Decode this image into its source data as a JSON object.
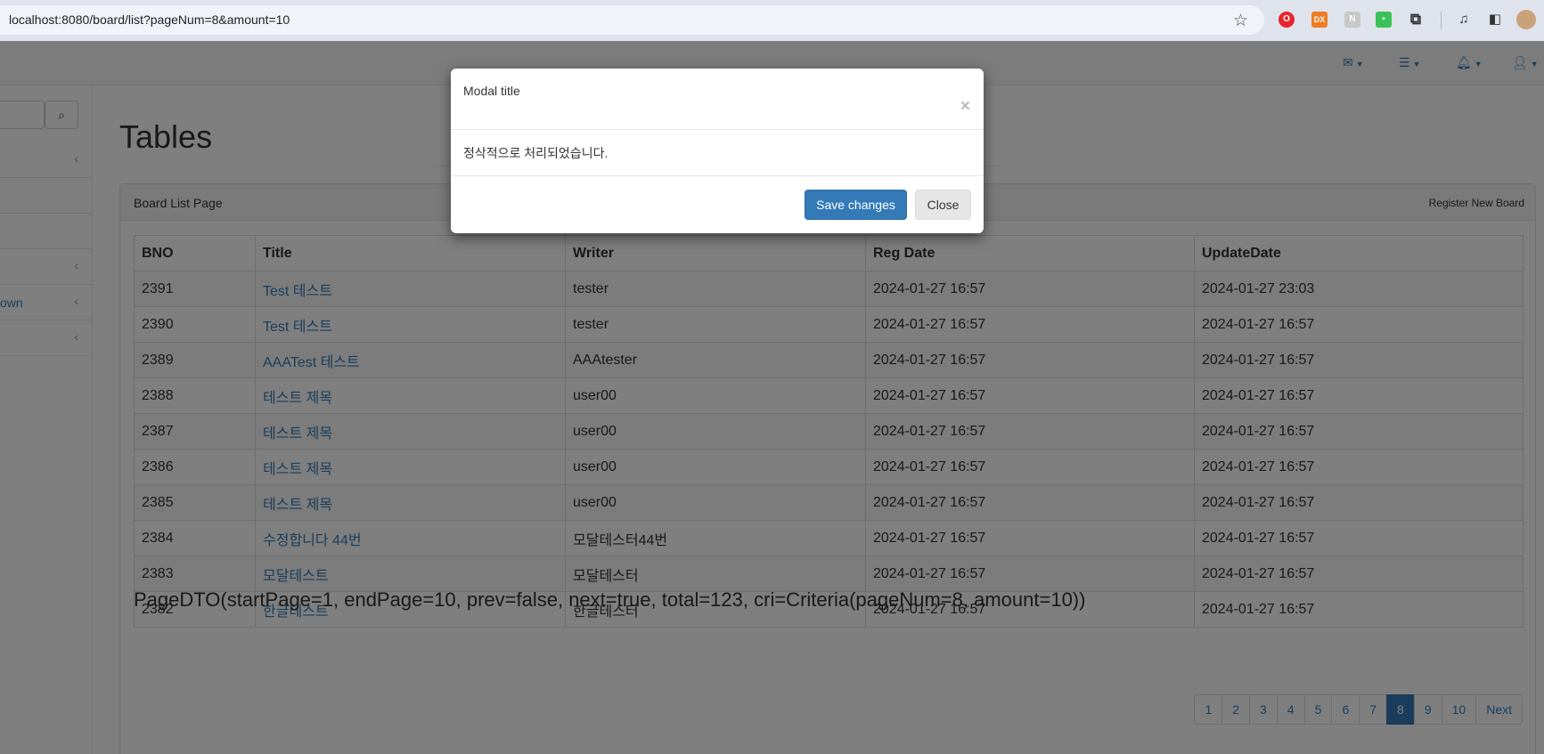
{
  "browser": {
    "url": "localhost:8080/board/list?pageNum=8&amount=10",
    "star_icon": "bookmark-star-icon",
    "extensions": [
      "opera-icon",
      "dx-icon",
      "n-icon",
      "green-ext-icon",
      "puzzle-icon",
      "media-icon",
      "sidepanel-icon",
      "profile-avatar-icon"
    ]
  },
  "header": {
    "icons": [
      "envelope-icon",
      "tasks-icon",
      "bell-icon",
      "user-icon"
    ]
  },
  "sidebar": {
    "search_icon": "search-icon",
    "items": [
      {
        "label": "",
        "has_chevron": true
      },
      {
        "label": "",
        "has_chevron": false
      },
      {
        "label": "",
        "has_chevron": false
      },
      {
        "label": "",
        "has_chevron": true
      },
      {
        "label": "own",
        "has_chevron": true
      },
      {
        "label": "",
        "has_chevron": true
      }
    ]
  },
  "main": {
    "page_title": "Tables",
    "panel_title": "Board List Page",
    "register_label": "Register New Board",
    "table": {
      "headers": [
        "BNO",
        "Title",
        "Writer",
        "Reg Date",
        "UpdateDate"
      ],
      "rows": [
        {
          "bno": "2391",
          "title": "Test 테스트",
          "writer": "tester",
          "reg": "2024-01-27 16:57",
          "upd": "2024-01-27 23:03"
        },
        {
          "bno": "2390",
          "title": "Test 테스트",
          "writer": "tester",
          "reg": "2024-01-27 16:57",
          "upd": "2024-01-27 16:57"
        },
        {
          "bno": "2389",
          "title": "AAATest 테스트",
          "writer": "AAAtester",
          "reg": "2024-01-27 16:57",
          "upd": "2024-01-27 16:57"
        },
        {
          "bno": "2388",
          "title": "테스트 제목",
          "writer": "user00",
          "reg": "2024-01-27 16:57",
          "upd": "2024-01-27 16:57"
        },
        {
          "bno": "2387",
          "title": "테스트 제목",
          "writer": "user00",
          "reg": "2024-01-27 16:57",
          "upd": "2024-01-27 16:57"
        },
        {
          "bno": "2386",
          "title": "테스트 제목",
          "writer": "user00",
          "reg": "2024-01-27 16:57",
          "upd": "2024-01-27 16:57"
        },
        {
          "bno": "2385",
          "title": "테스트 제목",
          "writer": "user00",
          "reg": "2024-01-27 16:57",
          "upd": "2024-01-27 16:57"
        },
        {
          "bno": "2384",
          "title": "수정합니다 44번",
          "writer": "모달테스터44번",
          "reg": "2024-01-27 16:57",
          "upd": "2024-01-27 16:57"
        },
        {
          "bno": "2383",
          "title": "모달테스트",
          "writer": "모달테스터",
          "reg": "2024-01-27 16:57",
          "upd": "2024-01-27 16:57"
        },
        {
          "bno": "2382",
          "title": "한글테스트",
          "writer": "한글테스터",
          "reg": "2024-01-27 16:57",
          "upd": "2024-01-27 16:57"
        }
      ]
    },
    "pagedto": "PageDTO(startPage=1, endPage=10, prev=false, next=true, total=123, cri=Criteria(pageNum=8, amount=10))",
    "pagination": {
      "pages": [
        "1",
        "2",
        "3",
        "4",
        "5",
        "6",
        "7",
        "8",
        "9",
        "10"
      ],
      "active": "8",
      "next_label": "Next"
    }
  },
  "modal": {
    "title": "Modal title",
    "close_glyph": "×",
    "body": "정삭적으로 처리되었습니다.",
    "save_label": "Save changes",
    "close_label": "Close"
  },
  "colors": {
    "primary": "#337ab7",
    "backdrop": "rgba(0,0,0,0.5)"
  }
}
